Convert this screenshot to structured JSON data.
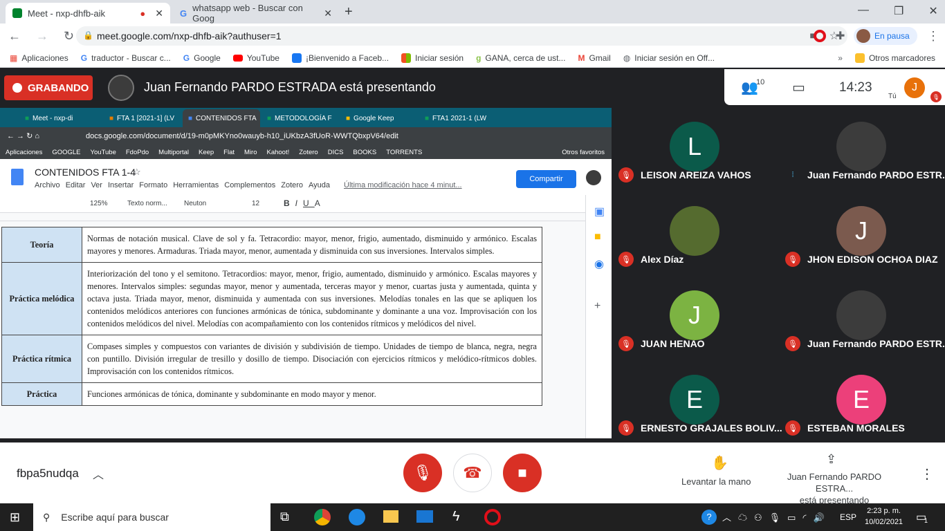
{
  "browser": {
    "tabs": [
      {
        "title": "Meet - nxp-dhfb-aik"
      },
      {
        "title": "whatsapp web - Buscar con Goog"
      }
    ],
    "url": "meet.google.com/nxp-dhfb-aik?authuser=1",
    "profile_status": "En pausa",
    "bookmarks": [
      "Aplicaciones",
      "traductor - Buscar c...",
      "Google",
      "YouTube",
      "¡Bienvenido a Faceb...",
      "Iniciar sesión",
      "GANA, cerca de ust...",
      "Gmail",
      "Iniciar sesión en Off..."
    ],
    "other_bookmarks": "Otros marcadores"
  },
  "meet": {
    "recording_label": "GRABANDO",
    "presenting_message": "Juan Fernando PARDO ESTRADA está presentando",
    "participant_count": "10",
    "time": "14:23",
    "self_initial": "J",
    "self_label": "Tú",
    "meeting_code": "fbpa5nudqa",
    "raise_hand_label": "Levantar la mano",
    "presenting_line1": "Juan Fernando PARDO ESTRA...",
    "presenting_line2": "está presentando",
    "participants": [
      {
        "name": "LEISON AREIZA VAHOS",
        "initial": "L",
        "color": "#0b5a4a"
      },
      {
        "name": "Juan Fernando PARDO ESTR...",
        "initial": "",
        "color": "#3c3c3c"
      },
      {
        "name": "Alex Díaz",
        "initial": "",
        "color": "#556b2f"
      },
      {
        "name": "JHON EDISON OCHOA DIAZ",
        "initial": "J",
        "color": "#7b5a4e"
      },
      {
        "name": "JUAN HENAO",
        "initial": "J",
        "color": "#7cb342"
      },
      {
        "name": "Juan Fernando PARDO ESTR...",
        "initial": "",
        "color": "#3c3c3c"
      },
      {
        "name": "ERNESTO GRAJALES BOLIV...",
        "initial": "E",
        "color": "#0b5a4a"
      },
      {
        "name": "ESTEBAN MORALES",
        "initial": "E",
        "color": "#ec407a"
      }
    ]
  },
  "shared": {
    "tabs": [
      "Meet - nxp-di",
      "FTA 1 [2021-1] (LV",
      "CONTENIDOS FTA",
      "METODOLOGÍA F",
      "Google Keep",
      "FTA1 2021-1 (LW"
    ],
    "url": "docs.google.com/document/d/19-m0pMKYno0wauyb-h10_iUKbzA3fUoR-WWTQbxpV64/edit",
    "bookmarks": [
      "Aplicaciones",
      "GOOGLE",
      "YouTube",
      "FdoPdo",
      "Multiportal",
      "Keep",
      "Flat",
      "Miro",
      "Kahoot!",
      "Zotero",
      "DICS",
      "BOOKS",
      "TORRENTS"
    ],
    "other_bookmarks": "Otros favoritos",
    "doc_title": "CONTENIDOS FTA 1-4",
    "menu": [
      "Archivo",
      "Editar",
      "Ver",
      "Insertar",
      "Formato",
      "Herramientas",
      "Complementos",
      "Zotero",
      "Ayuda"
    ],
    "last_edit": "Última modificación hace 4 minut...",
    "share_button": "Compartir",
    "zoom": "125%",
    "style": "Texto norm...",
    "font": "Neuton",
    "font_size": "12",
    "rows": [
      {
        "head": "Teoría",
        "text": "Normas de notación musical. Clave de sol y fa. Tetracordio: mayor, menor, frigio, aumentado, disminuido y armónico. Escalas mayores y menores. Armaduras. Triada mayor, menor, aumentada y disminuida con sus inversiones. Intervalos simples."
      },
      {
        "head": "Práctica melódica",
        "text": "Interiorización del tono y el semitono. Tetracordios: mayor, menor, frigio, aumentado, disminuido y armónico. Escalas mayores y menores. Intervalos simples: segundas mayor, menor y aumentada, terceras mayor y menor, cuartas justa y aumentada, quinta y octava justa. Triada mayor, menor, disminuida y aumentada con sus inversiones. Melodías tonales en las que se apliquen los contenidos melódicos anteriores con funciones armónicas de tónica, subdominante y dominante a una voz. Improvisación con los contenidos melódicos del nivel. Melodías con acompañamiento con los contenidos rítmicos y melódicos del nivel."
      },
      {
        "head": "Práctica rítmica",
        "text": "Compases simples y compuestos con variantes de división y subdivisión de tiempo. Unidades de tiempo de blanca, negra, negra con puntillo. División irregular de tresillo y dosillo de tiempo. Disociación con ejercicios rítmicos y melódico-rítmicos dobles. Improvisación con los contenidos rítmicos."
      },
      {
        "head": "Práctica",
        "text": "Funciones armónicas de tónica, dominante y subdominante en modo mayor y menor."
      }
    ]
  },
  "taskbar": {
    "search_placeholder": "Escribe aquí para buscar",
    "lang": "ESP",
    "time": "2:23 p. m.",
    "date": "10/02/2021",
    "notif_count": "1"
  }
}
